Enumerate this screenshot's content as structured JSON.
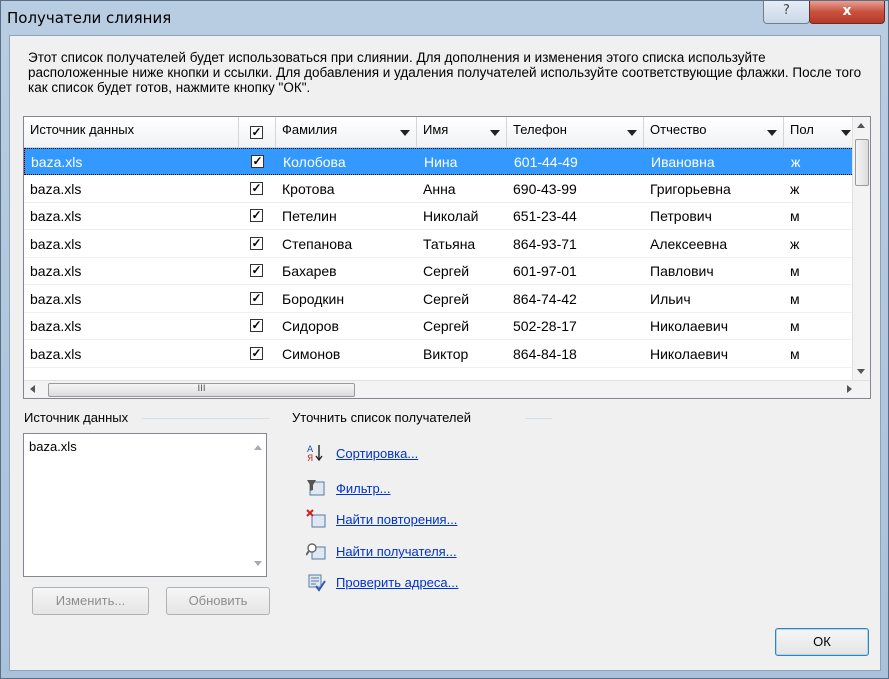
{
  "window": {
    "title": "Получатели слияния",
    "help": "?",
    "close": "x"
  },
  "intro": "Этот список получателей будет использоваться при слиянии. Для дополнения и изменения этого списка используйте расположенные ниже кнопки и ссылки. Для добавления и удаления получателей используйте соответствующие флажки. После того как список будет готов, нажмите кнопку \"ОК\".",
  "grid": {
    "columns": [
      "Источник данных",
      "",
      "Фамилия",
      "Имя",
      "Телефон",
      "Отчество",
      "Пол"
    ],
    "rows": [
      {
        "source": "baza.xls",
        "checked": true,
        "last": "Колобова",
        "first": "Нина",
        "phone": "601-44-49",
        "middle": "Ивановна",
        "sex": "ж"
      },
      {
        "source": "baza.xls",
        "checked": true,
        "last": "Кротова",
        "first": "Анна",
        "phone": "690-43-99",
        "middle": "Григорьевна",
        "sex": "ж"
      },
      {
        "source": "baza.xls",
        "checked": true,
        "last": "Петелин",
        "first": "Николай",
        "phone": "651-23-44",
        "middle": "Петрович",
        "sex": "м"
      },
      {
        "source": "baza.xls",
        "checked": true,
        "last": "Степанова",
        "first": "Татьяна",
        "phone": "864-93-71",
        "middle": "Алексеевна",
        "sex": "ж"
      },
      {
        "source": "baza.xls",
        "checked": true,
        "last": "Бахарев",
        "first": "Сергей",
        "phone": "601-97-01",
        "middle": "Павлович",
        "sex": "м"
      },
      {
        "source": "baza.xls",
        "checked": true,
        "last": "Бородкин",
        "first": "Сергей",
        "phone": "864-74-42",
        "middle": "Ильич",
        "sex": "м"
      },
      {
        "source": "baza.xls",
        "checked": true,
        "last": "Сидоров",
        "first": "Сергей",
        "phone": "502-28-17",
        "middle": "Николаевич",
        "sex": "м"
      },
      {
        "source": "baza.xls",
        "checked": true,
        "last": "Симонов",
        "first": "Виктор",
        "phone": "864-84-18",
        "middle": "Николаевич",
        "sex": "м"
      }
    ],
    "hscroll_thumb": "III"
  },
  "source_group": {
    "label": "Источник данных",
    "items": [
      "baza.xls"
    ],
    "edit": "Изменить...",
    "refresh": "Обновить"
  },
  "refine_group": {
    "label": "Уточнить список получателей",
    "links": [
      "Сортировка...",
      "Фильтр...",
      "Найти повторения...",
      "Найти получателя...",
      "Проверить адреса..."
    ],
    "icons": [
      "sort-icon",
      "filter-icon",
      "duplicates-icon",
      "find-recipient-icon",
      "validate-addresses-icon"
    ]
  },
  "ok": "ОК",
  "colors": {
    "selection": "#3399ff",
    "link": "#0033cc"
  }
}
